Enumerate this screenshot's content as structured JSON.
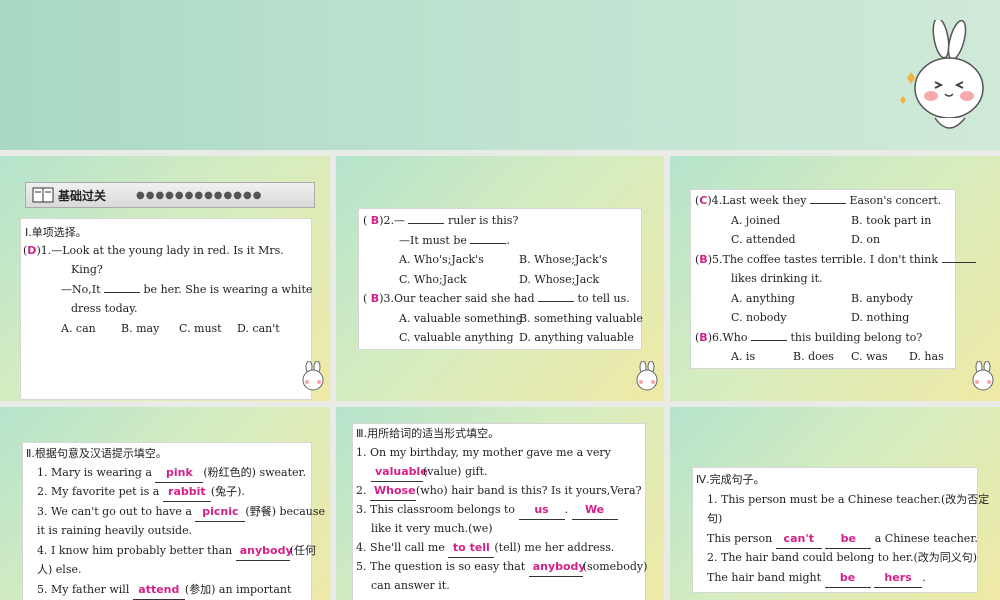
{
  "panel1": {
    "header": "基础过关",
    "section": "Ⅰ.单项选择。",
    "q1": {
      "answer": "D",
      "num": ")1.",
      "line1": "—Look at the young lady in red. Is it Mrs.",
      "line2": "King?",
      "line3a": "—No,It",
      "line3b": "be her. She is wearing a white",
      "line4": "dress today.",
      "options": [
        "A. can",
        "B. may",
        "C. must",
        "D. can't"
      ]
    }
  },
  "panel2": {
    "q2": {
      "answer": "B",
      "num": ")2.",
      "line1a": "—",
      "line1b": "ruler is this?",
      "line2a": "—It must be",
      "line2b": ".",
      "optA": "A. Who's;Jack's",
      "optB": "B. Whose;Jack's",
      "optC": "C. Who;Jack",
      "optD": "D. Whose;Jack"
    },
    "q3": {
      "answer": "B",
      "num": ")3.",
      "line1a": "Our teacher said she had",
      "line1b": "to tell us.",
      "optA": "A. valuable something",
      "optB": "B. something valuable",
      "optC": "C. valuable anything",
      "optD": "D. anything valuable"
    }
  },
  "panel3": {
    "q4": {
      "answer": "C",
      "num": ")4.",
      "line1a": "Last week they",
      "line1b": "Eason's concert.",
      "optA": "A. joined",
      "optB": "B. took part in",
      "optC": "C. attended",
      "optD": "D. on"
    },
    "q5": {
      "answer": "B",
      "num": ")5.",
      "line1a": "The coffee tastes terrible. I don't think",
      "line2": "likes drinking it.",
      "optA": "A. anything",
      "optB": "B. anybody",
      "optC": "C. nobody",
      "optD": "D. nothing"
    },
    "q6": {
      "answer": "B",
      "num": ")6.",
      "line1a": "Who",
      "line1b": "this building belong to?",
      "options": [
        "A. is",
        "B. does",
        "C. was",
        "D. has"
      ]
    }
  },
  "panel4": {
    "section": "Ⅱ.根据句意及汉语提示填空。",
    "items": [
      {
        "pre": "1. Mary is wearing a",
        "ans": "pink",
        "post": "(粉红色的) sweater."
      },
      {
        "pre": "2. My favorite pet is a",
        "ans": "rabbit",
        "post": "(兔子)."
      },
      {
        "pre": "3. We can't go out to have a",
        "ans": "picnic",
        "post": "(野餐) because"
      },
      {
        "pre": "4. I know him probably better than",
        "ans": "anybody",
        "post": "(任何"
      },
      {
        "pre": "5. My father will",
        "ans": "attend",
        "post": "(参加) an important"
      }
    ],
    "cont3": "it is raining heavily outside.",
    "cont4": "人) else."
  },
  "panel5": {
    "section": "Ⅲ.用所给词的适当形式填空。",
    "l1": "1. On my birthday, my mother gave me a very",
    "l2ans": "valuable",
    "l2post": "(value) gift.",
    "l3pre": "2.",
    "l3ans": "Whose",
    "l3post": "(who) hair band is this? Is it yours,Vera?",
    "l4pre": "3. This classroom belongs to",
    "l4ans1": "us",
    "l4mid": ".",
    "l4ans2": "We",
    "l5": "like it very much.(we)",
    "l6pre": "4. She'll call me",
    "l6ans": "to tell",
    "l6post": "(tell) me her address.",
    "l7pre": "5. The question is so easy that",
    "l7ans": "anybody",
    "l7post": "(somebody)",
    "l8": "can answer it."
  },
  "panel6": {
    "section": "Ⅳ.完成句子。",
    "l1": "1. This person must be a Chinese teacher.(改为否定",
    "l2": "句)",
    "l3pre": "This person",
    "l3ans1": "can't",
    "l3ans2": "be",
    "l3post": "a Chinese teacher.",
    "l4": "2. The hair band could belong to her.(改为同义句)",
    "l5pre": "The hair band might",
    "l5ans1": "be",
    "l5ans2": "hers",
    "l5post": "."
  },
  "colors": {
    "answer": "#d4208a",
    "banner": "#b7dfcb",
    "divider": "#e9ece6"
  },
  "icons": [
    "book-icon",
    "bunny-mascot-icon",
    "bunny-small-icon"
  ]
}
